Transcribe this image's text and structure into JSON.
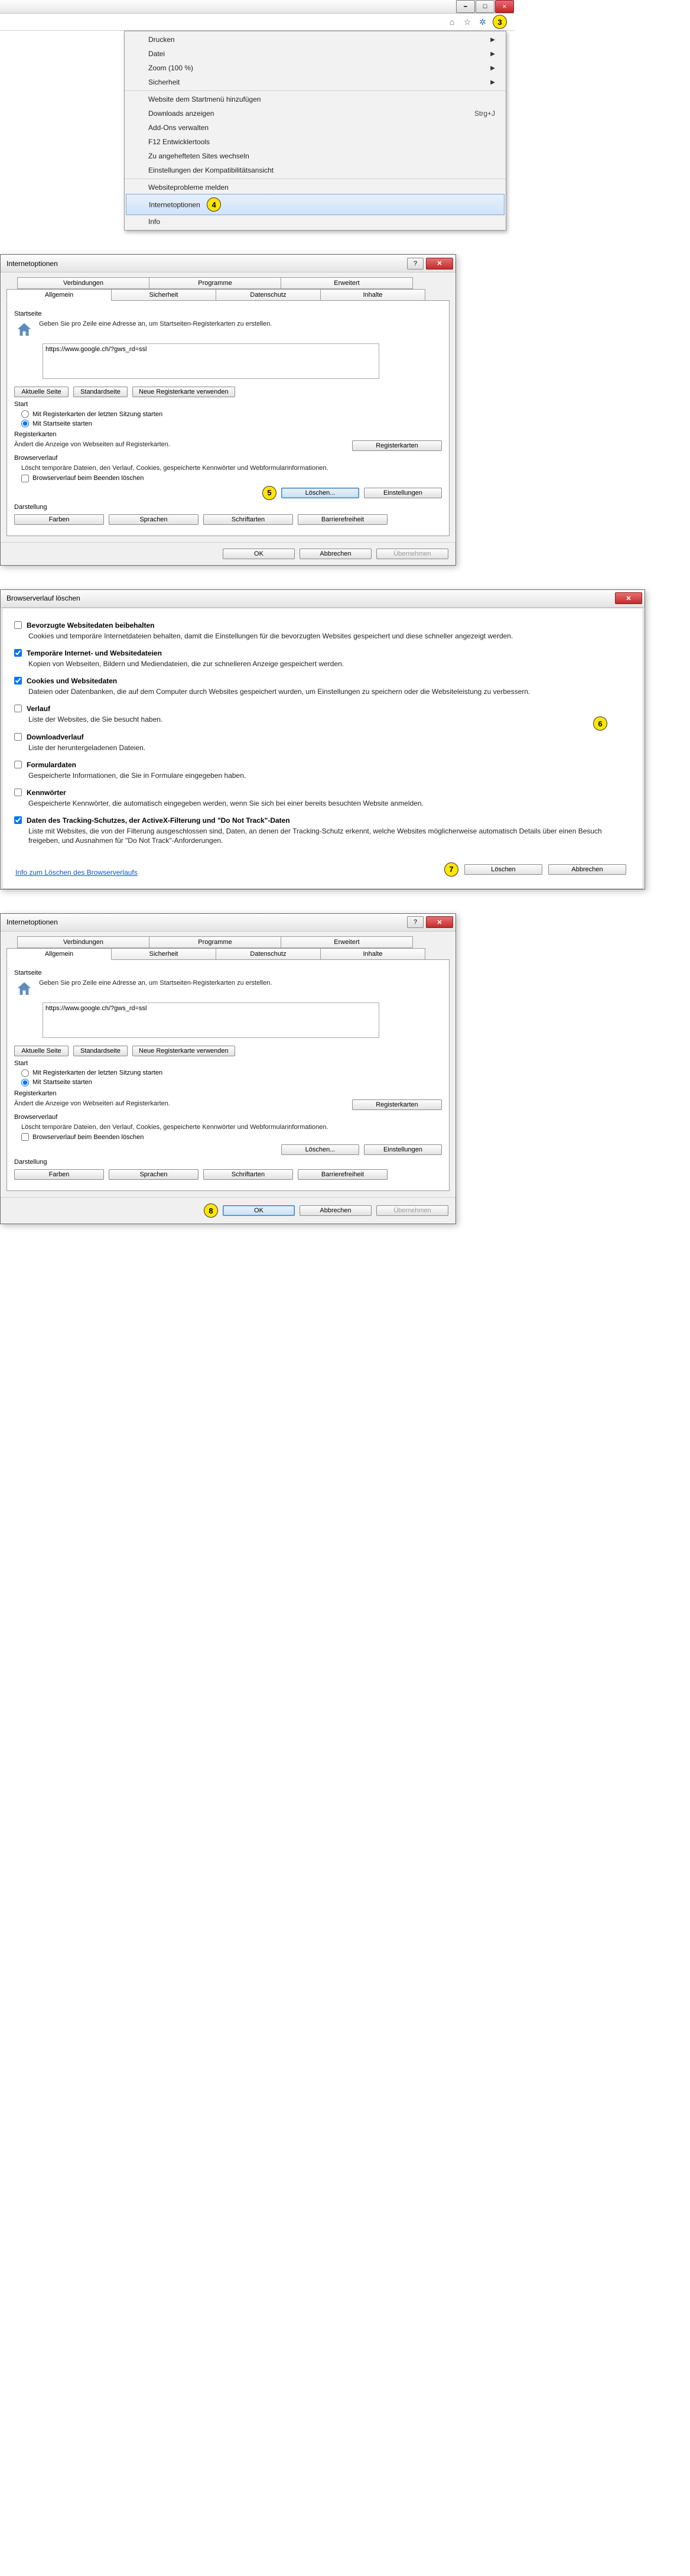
{
  "menu": {
    "items": [
      {
        "label": "Drucken",
        "arrow": true
      },
      {
        "label": "Datei",
        "arrow": true
      },
      {
        "label": "Zoom (100 %)",
        "arrow": true
      },
      {
        "label": "Sicherheit",
        "arrow": true
      }
    ],
    "items2": [
      {
        "label": "Website dem Startmenü hinzufügen"
      },
      {
        "label": "Downloads anzeigen",
        "shortcut": "Strg+J"
      },
      {
        "label": "Add-Ons verwalten"
      },
      {
        "label": "F12 Entwicklertools"
      },
      {
        "label": "Zu angehefteten Sites wechseln"
      },
      {
        "label": "Einstellungen der Kompatibilitätsansicht"
      }
    ],
    "items3": [
      {
        "label": "Websiteprobleme melden"
      },
      {
        "label": "Internetoptionen",
        "highlight": true,
        "marker": "4"
      },
      {
        "label": "Info"
      }
    ]
  },
  "markers": {
    "m3": "3",
    "m4": "4",
    "m5": "5",
    "m6": "6",
    "m7": "7",
    "m8": "8"
  },
  "opts": {
    "title": "Internetoptionen",
    "tabs_row1": [
      "Verbindungen",
      "Programme",
      "Erweitert"
    ],
    "tabs_row2": [
      "Allgemein",
      "Sicherheit",
      "Datenschutz",
      "Inhalte"
    ],
    "startseite": {
      "heading": "Startseite",
      "hint": "Geben Sie pro Zeile eine Adresse an, um Startseiten-Registerkarten zu erstellen.",
      "url": "https://www.google.ch/?gws_rd=ssl",
      "btn_current": "Aktuelle Seite",
      "btn_default": "Standardseite",
      "btn_newtab": "Neue Registerkarte verwenden"
    },
    "start": {
      "heading": "Start",
      "opt_last": "Mit Registerkarten der letzten Sitzung starten",
      "opt_home": "Mit Startseite starten"
    },
    "tabs_group": {
      "heading": "Registerkarten",
      "hint": "Ändert die Anzeige von Webseiten auf Registerkarten.",
      "btn": "Registerkarten"
    },
    "history": {
      "heading": "Browserverlauf",
      "hint": "Löscht temporäre Dateien, den Verlauf, Cookies, gespeicherte Kennwörter und Webformularinformationen.",
      "chk": "Browserverlauf beim Beenden löschen",
      "btn_delete": "Löschen...",
      "btn_settings": "Einstellungen"
    },
    "appearance": {
      "heading": "Darstellung",
      "btn_colors": "Farben",
      "btn_lang": "Sprachen",
      "btn_fonts": "Schriftarten",
      "btn_access": "Barrierefreiheit"
    },
    "footer": {
      "ok": "OK",
      "cancel": "Abbrechen",
      "apply": "Übernehmen"
    }
  },
  "hist": {
    "title": "Browserverlauf löschen",
    "items": [
      {
        "checked": false,
        "title": "Bevorzugte Websitedaten beibehalten",
        "desc": "Cookies und temporäre Internetdateien behalten, damit die Einstellungen für die bevorzugten Websites gespeichert und diese schneller angezeigt werden."
      },
      {
        "checked": true,
        "title": "Temporäre Internet- und Websitedateien",
        "desc": "Kopien von Webseiten, Bildern und Mediendateien, die zur schnelleren Anzeige gespeichert werden."
      },
      {
        "checked": true,
        "title": "Cookies und Websitedaten",
        "desc": "Dateien oder Datenbanken, die auf dem Computer durch Websites gespeichert wurden, um Einstellungen zu speichern oder die Websiteleistung zu verbessern."
      },
      {
        "checked": false,
        "title": "Verlauf",
        "desc": "Liste der Websites, die Sie besucht haben."
      },
      {
        "checked": false,
        "title": "Downloadverlauf",
        "desc": "Liste der heruntergeladenen Dateien."
      },
      {
        "checked": false,
        "title": "Formulardaten",
        "desc": "Gespeicherte Informationen, die Sie in Formulare eingegeben haben."
      },
      {
        "checked": false,
        "title": "Kennwörter",
        "desc": "Gespeicherte Kennwörter, die automatisch eingegeben werden, wenn Sie sich bei einer bereits besuchten Website anmelden."
      },
      {
        "checked": true,
        "title": "Daten des Tracking-Schutzes, der ActiveX-Filterung und \"Do Not Track\"-Daten",
        "desc": "Liste mit Websites, die von der Filterung ausgeschlossen sind, Daten, an denen der Tracking-Schutz erkennt, welche Websites möglicherweise automatisch Details über einen Besuch freigeben, und Ausnahmen für \"Do Not Track\"-Anforderungen."
      }
    ],
    "link": "Info zum Löschen des Browserverlaufs",
    "btn_delete": "Löschen",
    "btn_cancel": "Abbrechen"
  }
}
